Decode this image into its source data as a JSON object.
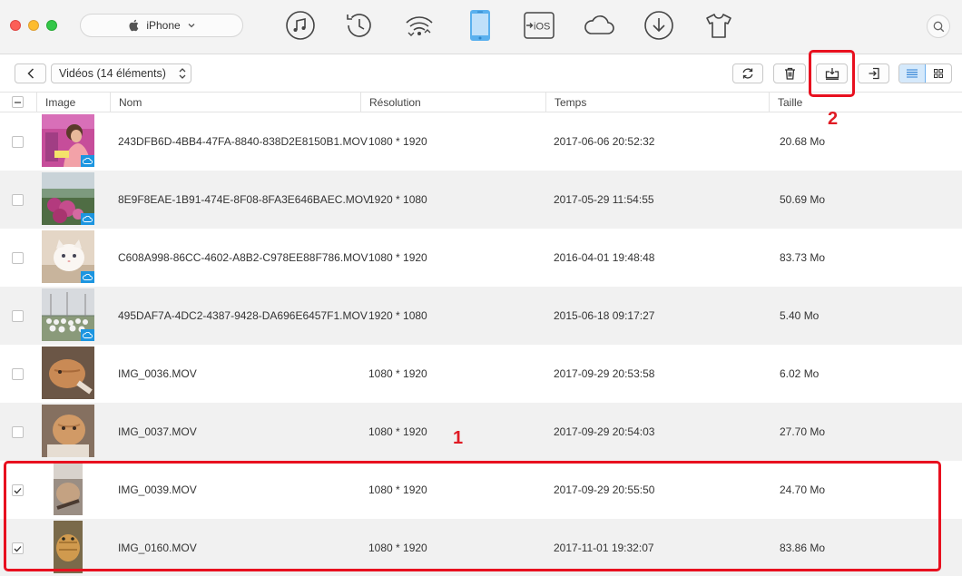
{
  "titlebar": {
    "device_name": "iPhone",
    "nav_icons": [
      "music-icon",
      "history-icon",
      "wifi-transfer-icon",
      "iphone-icon",
      "to-ios-icon",
      "icloud-icon",
      "download-icon",
      "tshirt-icon"
    ],
    "to_ios_label": "iOS",
    "active_nav": "iphone-icon"
  },
  "toolbar": {
    "category_label": "Vidéos (14 éléments)",
    "buttons": [
      "back-icon",
      "refresh-icon",
      "trash-icon",
      "export-to-computer-icon",
      "import-icon",
      "list-view-icon",
      "grid-view-icon"
    ]
  },
  "table": {
    "columns": {
      "image": "Image",
      "name": "Nom",
      "resolution": "Résolution",
      "time": "Temps",
      "size": "Taille"
    },
    "rows": [
      {
        "name": "243DFB6D-4BB4-47FA-8840-838D2E8150B1.MOV",
        "resolution": "1080 * 1920",
        "time": "2017-06-06 20:52:32",
        "size": "20.68 Mo",
        "checked": false,
        "icloud": true
      },
      {
        "name": "8E9F8EAE-1B91-474E-8F08-8FA3E646BAEC.MOV",
        "resolution": "1920 * 1080",
        "time": "2017-05-29 11:54:55",
        "size": "50.69 Mo",
        "checked": false,
        "icloud": true
      },
      {
        "name": "C608A998-86CC-4602-A8B2-C978EE88F786.MOV",
        "resolution": "1080 * 1920",
        "time": "2016-04-01 19:48:48",
        "size": "83.73 Mo",
        "checked": false,
        "icloud": true
      },
      {
        "name": "495DAF7A-4DC2-4387-9428-DA696E6457F1.MOV",
        "resolution": "1920 * 1080",
        "time": "2015-06-18 09:17:27",
        "size": "5.40 Mo",
        "checked": false,
        "icloud": true
      },
      {
        "name": "IMG_0036.MOV",
        "resolution": "1080 * 1920",
        "time": "2017-09-29 20:53:58",
        "size": "6.02 Mo",
        "checked": false,
        "icloud": false
      },
      {
        "name": "IMG_0037.MOV",
        "resolution": "1080 * 1920",
        "time": "2017-09-29 20:54:03",
        "size": "27.70 Mo",
        "checked": false,
        "icloud": false
      },
      {
        "name": "IMG_0039.MOV",
        "resolution": "1080 * 1920",
        "time": "2017-09-29 20:55:50",
        "size": "24.70 Mo",
        "checked": true,
        "icloud": false
      },
      {
        "name": "IMG_0160.MOV",
        "resolution": "1080 * 1920",
        "time": "2017-11-01 19:32:07",
        "size": "83.86 Mo",
        "checked": true,
        "icloud": false
      }
    ]
  },
  "annotations": {
    "step1": "1",
    "step2": "2",
    "color": "#e8101f"
  },
  "colors": {
    "accent_blue": "#1c95e0",
    "active_view_bg": "#d5e9fb"
  }
}
